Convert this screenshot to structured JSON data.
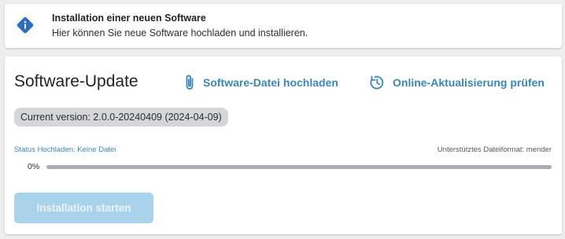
{
  "info": {
    "icon": "info-icon",
    "title": "Installation einer neuen Software",
    "subtitle": "Hier können Sie neue Software hochladen und installieren."
  },
  "update": {
    "title": "Software-Update",
    "upload_action": {
      "icon": "paperclip-icon",
      "label": "Software-Datei hochladen"
    },
    "online_action": {
      "icon": "refresh-clock-icon",
      "label": "Online-Aktualisierung prüfen"
    },
    "current_version": "Current version: 2.0.0-20240409 (2024-04-09)",
    "status_label": "Status Hochladen: Keine Datei",
    "format_label": "Unterstütztes Dateiformat: mender",
    "progress_text": "0%",
    "progress_value": 0,
    "install_button": "Installation starten",
    "install_enabled": false
  },
  "colors": {
    "accent": "#3a86b8",
    "info_icon": "#2d6fbf",
    "badge_bg": "#d5d6d8",
    "button_disabled_bg": "#a9d3ea",
    "progress_track": "#a9acb8",
    "page_bg": "#eceef0"
  }
}
